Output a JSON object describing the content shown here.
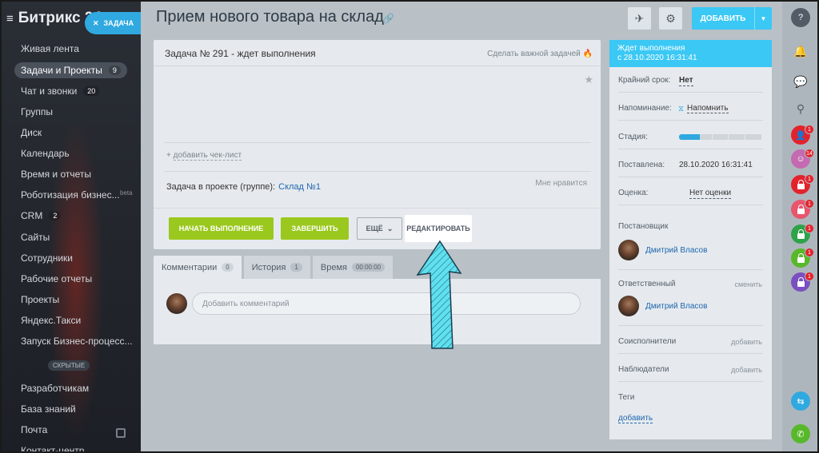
{
  "sidebar": {
    "brand": "Битрикс 24",
    "task_button": "ЗАДАЧА",
    "items": [
      {
        "label": "Живая лента",
        "count": ""
      },
      {
        "label": "Задачи и Проекты",
        "count": "9"
      },
      {
        "label": "Чат и звонки",
        "count": "20"
      },
      {
        "label": "Группы",
        "count": ""
      },
      {
        "label": "Диск",
        "count": ""
      },
      {
        "label": "Календарь",
        "count": ""
      },
      {
        "label": "Время и отчеты",
        "count": ""
      },
      {
        "label": "Роботизация бизнес...",
        "count": ""
      },
      {
        "label": "CRM",
        "count": "2"
      },
      {
        "label": "Сайты",
        "count": ""
      },
      {
        "label": "Сотрудники",
        "count": ""
      },
      {
        "label": "Рабочие отчеты",
        "count": ""
      },
      {
        "label": "Проекты",
        "count": ""
      },
      {
        "label": "Яндекс.Такси",
        "count": ""
      },
      {
        "label": "Запуск Бизнес-процесс...",
        "count": ""
      },
      {
        "label": "Разработчикам",
        "count": ""
      },
      {
        "label": "База знаний",
        "count": ""
      },
      {
        "label": "Почта",
        "count": ""
      },
      {
        "label": "Контакт-центр",
        "count": ""
      }
    ],
    "beta_label": "beta",
    "hidden_label": "СКРЫТЫЕ"
  },
  "header": {
    "title": "Прием нового товара на склад",
    "add_label": "ДОБАВИТЬ"
  },
  "task": {
    "heading": "Задача № 291 - ждет выполнения",
    "important": "Сделать важной задачей",
    "checklist": "добавить чек-лист",
    "project_label": "Задача в проекте (группе):",
    "project_value": "Склад №1",
    "like": "Мне нравится",
    "btn_start": "НАЧАТЬ ВЫПОЛНЕНИЕ",
    "btn_finish": "ЗАВЕРШИТЬ",
    "btn_more": "ЕЩЁ",
    "btn_edit": "РЕДАКТИРОВАТЬ"
  },
  "tabs": [
    {
      "label": "Комментарии",
      "count": "0"
    },
    {
      "label": "История",
      "count": "1"
    },
    {
      "label": "Время",
      "count": "00:00:00"
    }
  ],
  "comment_placeholder": "Добавить комментарий",
  "info": {
    "status_line1": "Ждет выполнения",
    "status_line2": "с 28.10.2020 16:31:41",
    "deadline_label": "Крайний срок:",
    "deadline_value": "Нет",
    "reminder_label": "Напоминание:",
    "reminder_value": "Напомнить",
    "stage_label": "Стадия:",
    "stage_progress": 0.25,
    "created_label": "Поставлена:",
    "created_value": "28.10.2020 16:31:41",
    "rating_label": "Оценка:",
    "rating_value": "Нет оценки",
    "creator_label": "Постановщик",
    "creator_name": "Дмитрий Власов",
    "responsible_label": "Ответственный",
    "change_link": "сменить",
    "responsible_name": "Дмитрий Власов",
    "coexecutors_label": "Соисполнители",
    "observers_label": "Наблюдатели",
    "add_link": "добавить",
    "tags_label": "Теги",
    "tags_add": "добавить"
  },
  "rail": {
    "badges": [
      "1",
      "14",
      "1",
      "1",
      "1",
      "1",
      "1"
    ],
    "colors": {
      "red": "#e3232c",
      "pink": "#e8556c",
      "green": "#2fa24a",
      "lightgreen": "#58b82b",
      "purple": "#7a4fc0",
      "teal": "#2fa9e0",
      "call": "#58b82b"
    }
  }
}
